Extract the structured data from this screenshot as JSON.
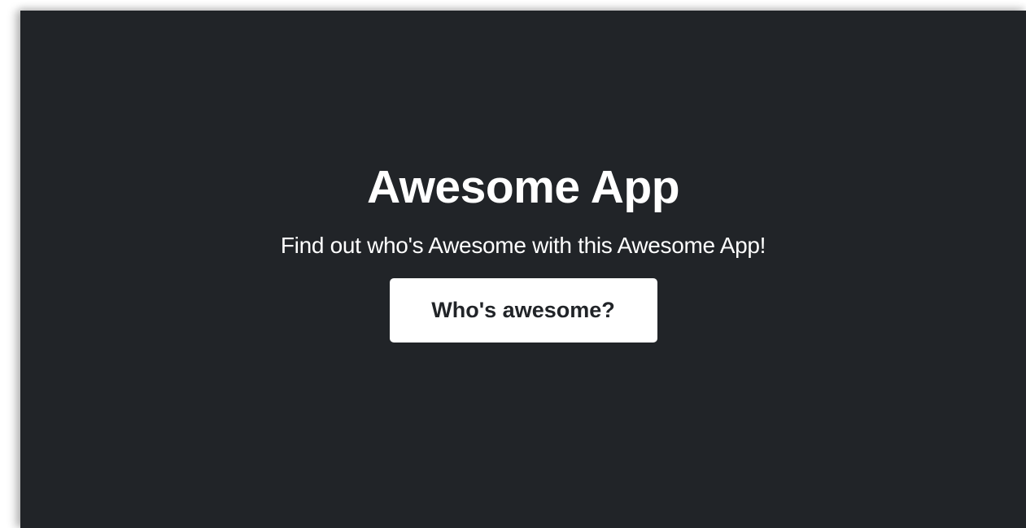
{
  "hero": {
    "title": "Awesome App",
    "subtitle": "Find out who's Awesome with this Awesome App!",
    "button_label": "Who's awesome?"
  },
  "colors": {
    "background": "#212428",
    "text": "#ffffff",
    "button_background": "#ffffff",
    "button_text": "#212428"
  }
}
